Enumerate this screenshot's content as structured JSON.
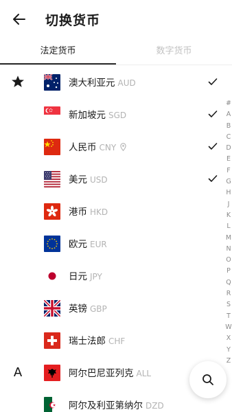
{
  "header": {
    "title": "切换货币"
  },
  "tabs": [
    {
      "label": "法定货币",
      "active": true
    },
    {
      "label": "数字货币",
      "active": false
    }
  ],
  "currencies": [
    {
      "section": "star",
      "flag": "australia",
      "name": "澳大利亚元",
      "code": "AUD",
      "selected": true
    },
    {
      "section": "",
      "flag": "singapore",
      "name": "新加坡元",
      "code": "SGD",
      "selected": true
    },
    {
      "section": "",
      "flag": "china",
      "name": "人民币",
      "code": "CNY",
      "selected": true,
      "location": true
    },
    {
      "section": "",
      "flag": "usa",
      "name": "美元",
      "code": "USD",
      "selected": true
    },
    {
      "section": "",
      "flag": "hongkong",
      "name": "港币",
      "code": "HKD",
      "selected": false
    },
    {
      "section": "",
      "flag": "eu",
      "name": "欧元",
      "code": "EUR",
      "selected": false
    },
    {
      "section": "",
      "flag": "japan",
      "name": "日元",
      "code": "JPY",
      "selected": false
    },
    {
      "section": "",
      "flag": "uk",
      "name": "英镑",
      "code": "GBP",
      "selected": false
    },
    {
      "section": "",
      "flag": "switzerland",
      "name": "瑞士法郎",
      "code": "CHF",
      "selected": false
    },
    {
      "section": "A",
      "flag": "albania",
      "name": "阿尔巴尼亚列克",
      "code": "ALL",
      "selected": false
    },
    {
      "section": "",
      "flag": "algeria",
      "name": "阿尔及利亚第纳尔",
      "code": "DZD",
      "selected": false
    }
  ],
  "index_letters": [
    "#",
    "A",
    "B",
    "C",
    "D",
    "E",
    "F",
    "G",
    "H",
    "J",
    "K",
    "L",
    "M",
    "N",
    "O",
    "P",
    "Q",
    "R",
    "S",
    "T",
    "W",
    "X",
    "Y",
    "Z"
  ],
  "colors": {
    "accent": "#1a1a1a",
    "muted": "#b3b3b3"
  }
}
